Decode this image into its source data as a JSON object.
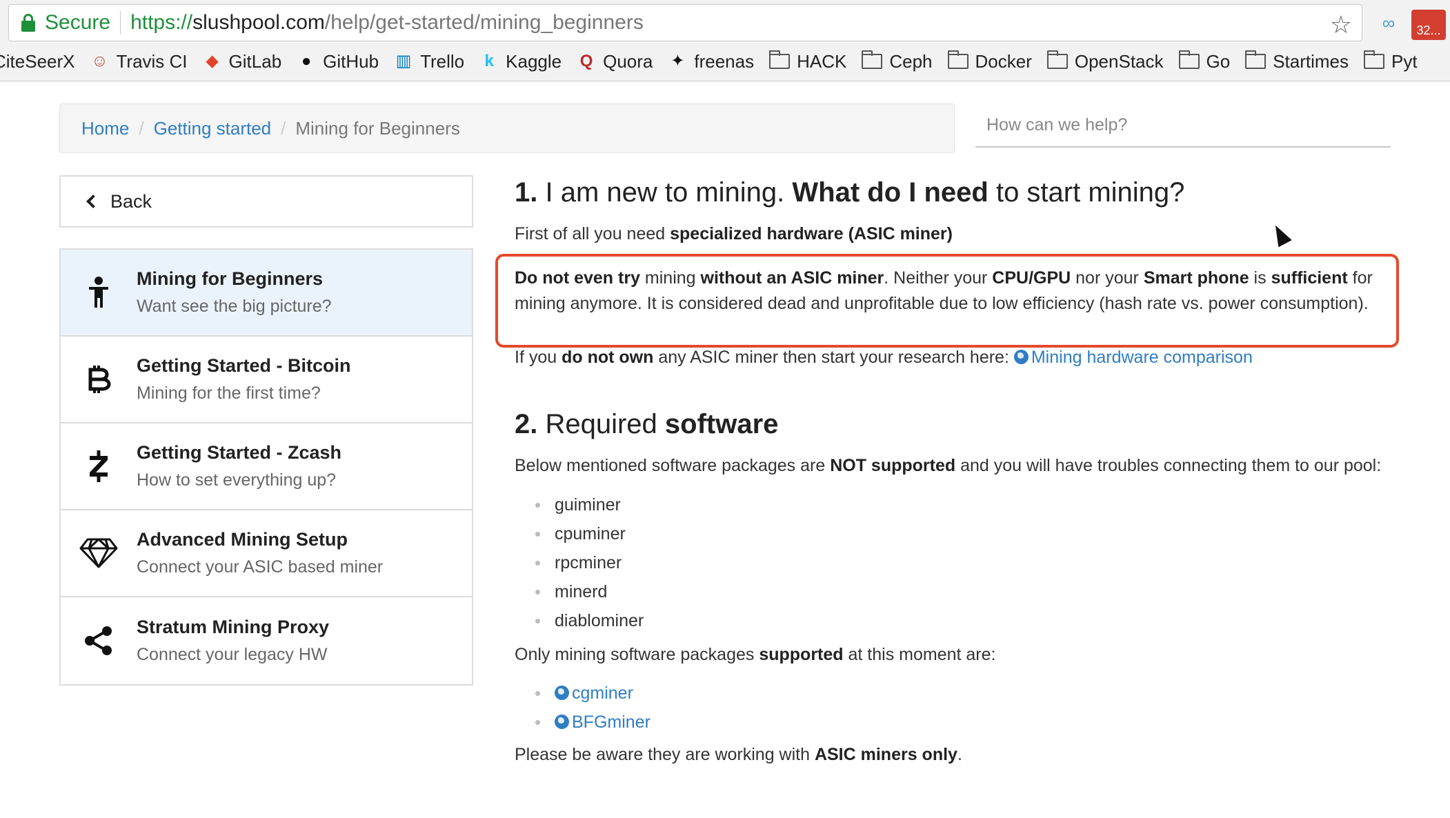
{
  "browser": {
    "secure_label": "Secure",
    "url_proto": "https://",
    "url_host": "slushpool.com",
    "url_path": "/help/get-started/mining_beginners",
    "ext_badge": "32...",
    "bookmarks": [
      {
        "label": "CiteSeerX",
        "icon": "citeseerx-icon"
      },
      {
        "label": "Travis CI",
        "icon": "travis-icon"
      },
      {
        "label": "GitLab",
        "icon": "gitlab-icon"
      },
      {
        "label": "GitHub",
        "icon": "github-icon"
      },
      {
        "label": "Trello",
        "icon": "trello-icon"
      },
      {
        "label": "Kaggle",
        "icon": "kaggle-icon"
      },
      {
        "label": "Quora",
        "icon": "quora-icon"
      },
      {
        "label": "freenas",
        "icon": "freenas-icon"
      },
      {
        "label": "HACK",
        "icon": "folder-icon"
      },
      {
        "label": "Ceph",
        "icon": "folder-icon"
      },
      {
        "label": "Docker",
        "icon": "folder-icon"
      },
      {
        "label": "OpenStack",
        "icon": "folder-icon"
      },
      {
        "label": "Go",
        "icon": "folder-icon"
      },
      {
        "label": "Startimes",
        "icon": "folder-icon"
      },
      {
        "label": "Pyt",
        "icon": "folder-icon"
      }
    ]
  },
  "breadcrumb": {
    "home": "Home",
    "section": "Getting started",
    "current": "Mining for Beginners"
  },
  "search": {
    "placeholder": "How can we help?"
  },
  "sidebar": {
    "back_label": "Back",
    "items": [
      {
        "title": "Mining for Beginners",
        "subtitle": "Want see the big picture?",
        "icon": "person-icon",
        "active": true
      },
      {
        "title": "Getting Started - Bitcoin",
        "subtitle": "Mining for the first time?",
        "icon": "bitcoin-icon",
        "active": false
      },
      {
        "title": "Getting Started - Zcash",
        "subtitle": "How to set everything up?",
        "icon": "zcash-icon",
        "active": false
      },
      {
        "title": "Advanced Mining Setup",
        "subtitle": "Connect your ASIC based miner",
        "icon": "diamond-icon",
        "active": false
      },
      {
        "title": "Stratum Mining Proxy",
        "subtitle": "Connect your legacy HW",
        "icon": "share-icon",
        "active": false
      }
    ]
  },
  "content": {
    "s1_num": "1.",
    "s1_a": " I am new to mining. ",
    "s1_b": "What do I need",
    "s1_c": " to start mining?",
    "p1_a": "First of all you need ",
    "p1_b": "specialized hardware (ASIC miner)",
    "hl_1": "Do not even try",
    "hl_2": " mining ",
    "hl_3": "without an ASIC miner",
    "hl_4": ". Neither your ",
    "hl_5": "CPU/GPU",
    "hl_6": " nor your ",
    "hl_7": "Smart phone",
    "hl_8": " is ",
    "hl_9": "sufficient",
    "hl_10": " for mining anymore. It is considered dead and unprofitable due to low efficiency (hash rate vs. power consumption).",
    "p2_a": "If you ",
    "p2_b": "do not own",
    "p2_c": " any ASIC miner then start your research here: ",
    "p2_link": "Mining hardware comparison",
    "s2_num": "2.",
    "s2_a": " Required ",
    "s2_b": "software",
    "p3_a": "Below mentioned software packages are ",
    "p3_b": "NOT supported",
    "p3_c": " and you will have troubles connecting them to our pool:",
    "unsupported": [
      "guiminer",
      "cpuminer",
      "rpcminer",
      "minerd",
      "diablominer"
    ],
    "p4_a": "Only mining software packages ",
    "p4_b": "supported",
    "p4_c": " at this moment are:",
    "supported": [
      "cgminer",
      "BFGminer"
    ],
    "p5_a": "Please be aware they are working with ",
    "p5_b": "ASIC miners only",
    "p5_c": "."
  },
  "colors": {
    "link": "#2f7dc4",
    "highlight_border": "#e24a2c",
    "secure_green": "#1f8f3a",
    "active_item_bg": "#eaf3fb"
  }
}
